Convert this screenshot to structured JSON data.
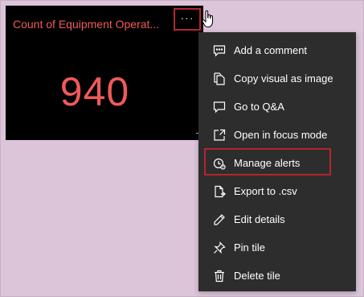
{
  "tile": {
    "title": "Count of Equipment Operat...",
    "value": "940",
    "more_label": "···"
  },
  "menu": {
    "items": [
      {
        "label": "Add a comment",
        "icon": "comment-icon"
      },
      {
        "label": "Copy visual as image",
        "icon": "copy-icon"
      },
      {
        "label": "Go to Q&A",
        "icon": "qa-icon"
      },
      {
        "label": "Open in focus mode",
        "icon": "focus-mode-icon"
      },
      {
        "label": "Manage alerts",
        "icon": "alert-clock-icon"
      },
      {
        "label": "Export to .csv",
        "icon": "export-file-icon"
      },
      {
        "label": "Edit details",
        "icon": "pencil-icon"
      },
      {
        "label": "Pin tile",
        "icon": "pin-icon"
      },
      {
        "label": "Delete tile",
        "icon": "trash-icon"
      }
    ]
  },
  "colors": {
    "background": "#dcc4d9",
    "tile_bg": "#000000",
    "accent_text": "#f05a5a",
    "menu_bg": "#2d2d2d",
    "highlight_border": "#b5262f"
  }
}
